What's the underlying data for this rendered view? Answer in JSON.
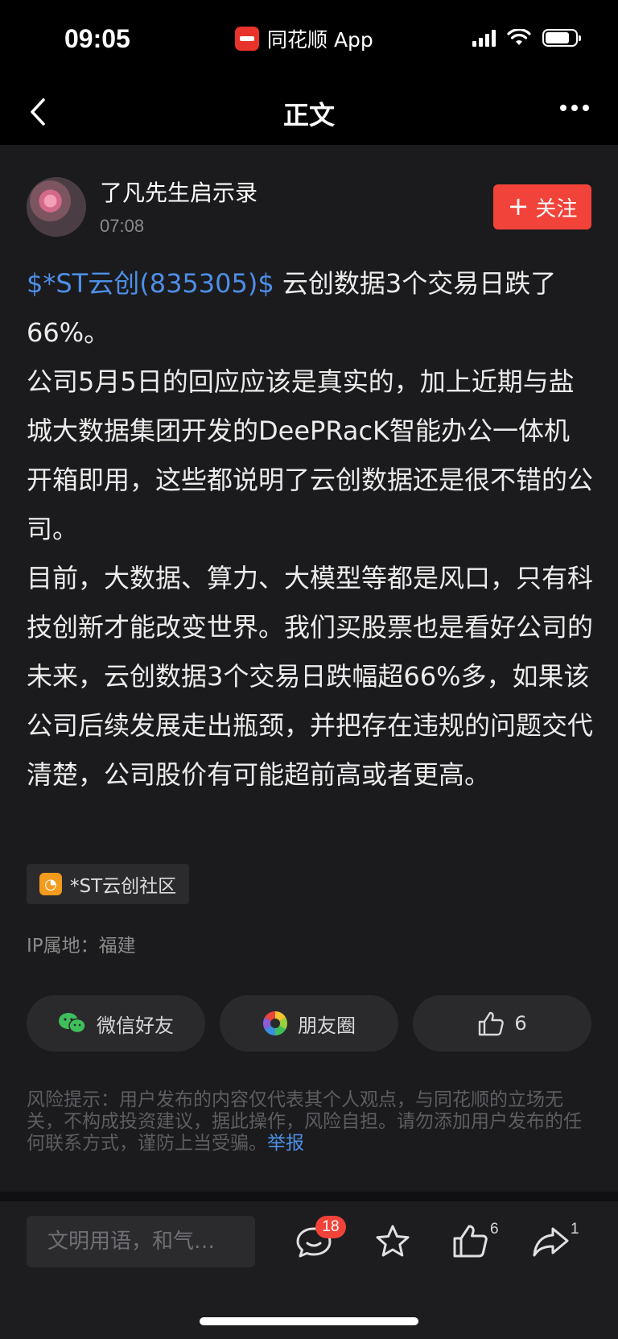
{
  "status_bar": {
    "time": "09:05",
    "app_name": "同花顺 App",
    "battery_percent": 80
  },
  "nav": {
    "title": "正文"
  },
  "post": {
    "author": "了凡先生启示录",
    "time": "07:08",
    "follow_label": "关注",
    "stock_link": "$*ST云创(835305)$",
    "paragraphs": [
      " 云创数据3个交易日跌了66%。",
      "公司5月5日的回应应该是真实的，加上近期与盐城大数据集团开发的DeePRacK智能办公一体机开箱即用，这些都说明了云创数据还是很不错的公司。",
      "目前，大数据、算力、大模型等都是风口，只有科技创新才能改变世界。我们买股票也是看好公司的未来，云创数据3个交易日跌幅超66%多，如果该公司后续发展走出瓶颈，并把存在违规的问题交代清楚，公司股价有可能超前高或者更高。"
    ],
    "community_tag": "*ST云创社区",
    "ip_location": "IP属地：福建"
  },
  "share": {
    "wechat_label": "微信好友",
    "moments_label": "朋友圈",
    "like_count": "6"
  },
  "risk": {
    "text": "风险提示：用户发布的内容仅代表其个人观点，与同花顺的立场无关，不构成投资建议，据此操作，风险自担。请勿添加用户发布的任何联系方式，谨防上当受骗。",
    "report_label": "举报"
  },
  "bottom_bar": {
    "comment_placeholder": "文明用语，和气…",
    "comment_count": "18",
    "like_count": "6",
    "share_count": "1"
  },
  "colors": {
    "accent_red": "#f2433a",
    "link_blue": "#4d8fe6",
    "background": "#1b1b1d"
  }
}
